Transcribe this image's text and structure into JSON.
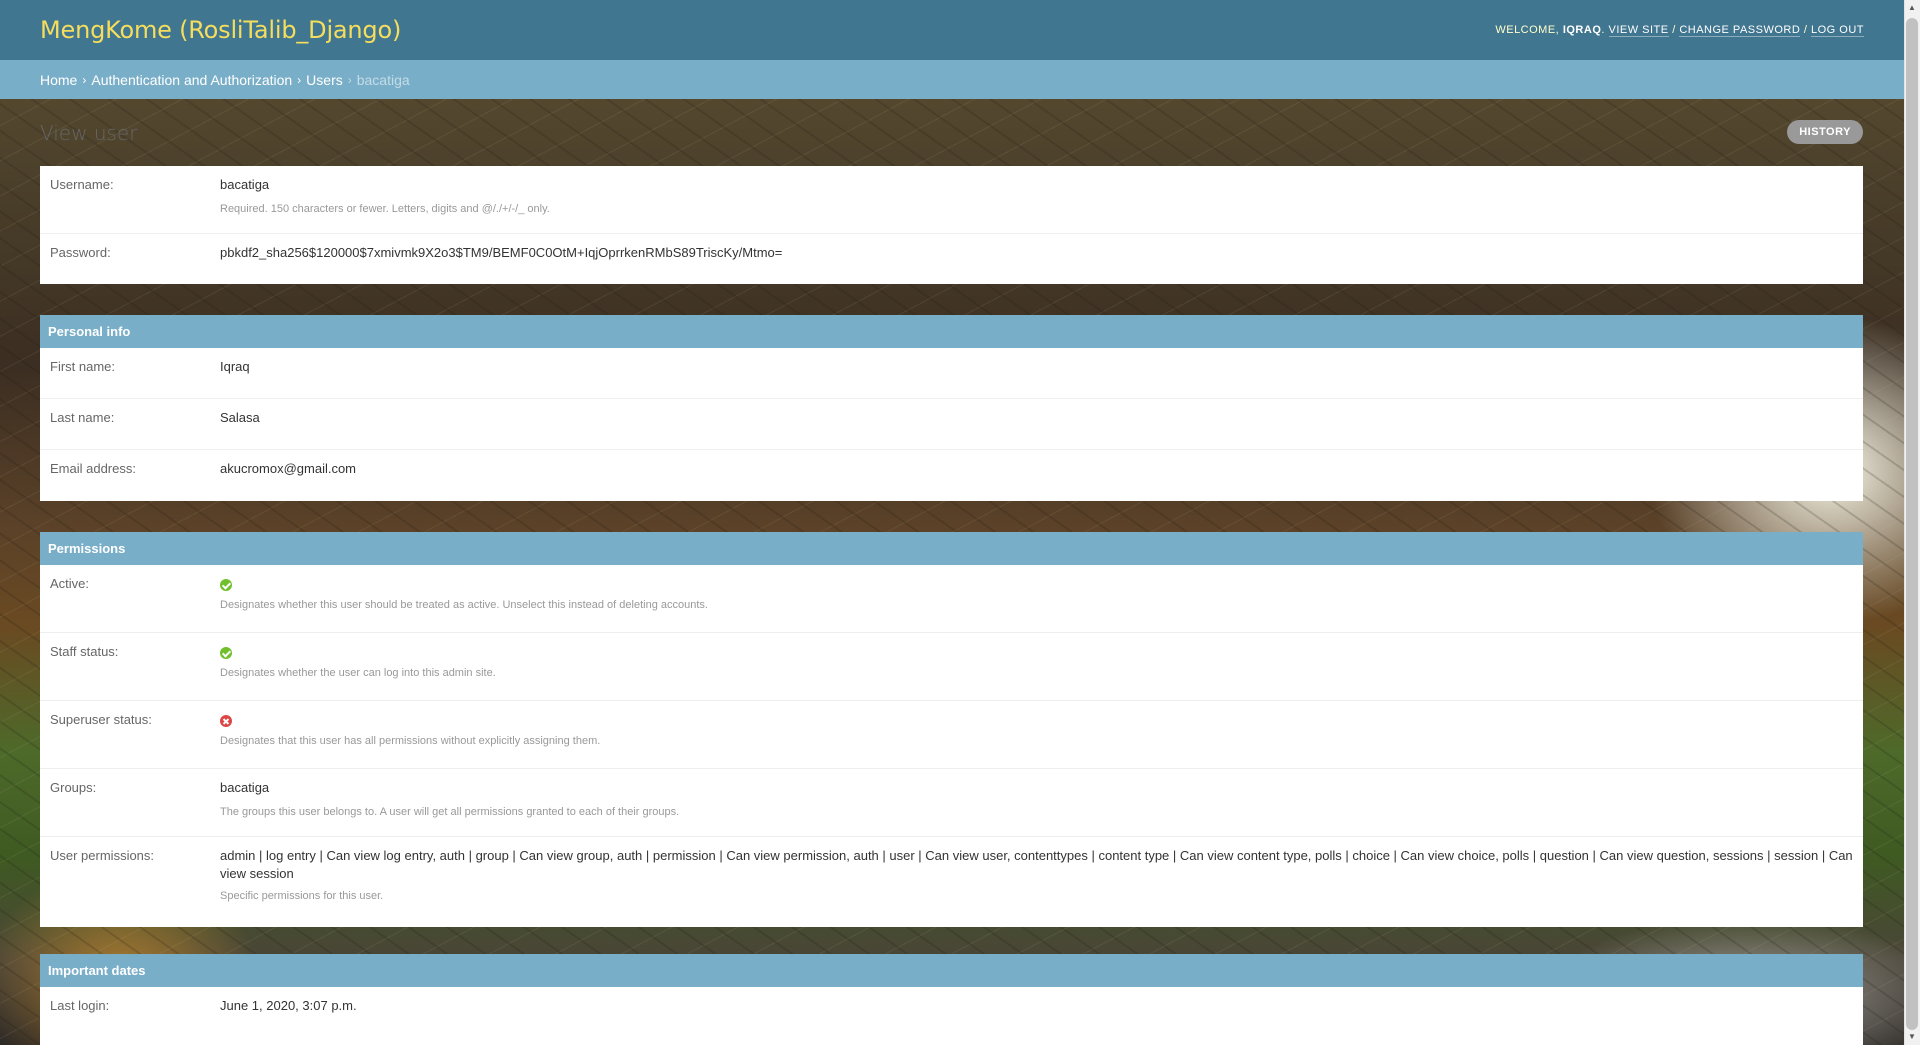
{
  "header": {
    "site_name": "MengKome (RosliTalib_Django)",
    "welcome": "Welcome,",
    "username": "IQRAQ",
    "view_site": "View site",
    "change_password": "Change password",
    "log_out": "Log out"
  },
  "breadcrumbs": {
    "home": "Home",
    "app": "Authentication and Authorization",
    "model": "Users",
    "current": "bacatiga"
  },
  "content": {
    "title": "View user",
    "history_label": "History"
  },
  "account": {
    "username_label": "Username:",
    "username_value": "bacatiga",
    "username_help": "Required. 150 characters or fewer. Letters, digits and @/./+/-/_ only.",
    "password_label": "Password:",
    "password_value": "pbkdf2_sha256$120000$7xmivmk9X2o3$TM9/BEMF0C0OtM+IqjOprrkenRMbS89TriscKy/Mtmo="
  },
  "personal_info": {
    "heading": "Personal info",
    "first_name_label": "First name:",
    "first_name_value": "Iqraq",
    "last_name_label": "Last name:",
    "last_name_value": "Salasa",
    "email_label": "Email address:",
    "email_value": "akucromox@gmail.com"
  },
  "permissions": {
    "heading": "Permissions",
    "active_label": "Active:",
    "active_value": true,
    "active_help": "Designates whether this user should be treated as active. Unselect this instead of deleting accounts.",
    "staff_label": "Staff status:",
    "staff_value": true,
    "staff_help": "Designates whether the user can log into this admin site.",
    "superuser_label": "Superuser status:",
    "superuser_value": false,
    "superuser_help": "Designates that this user has all permissions without explicitly assigning them.",
    "groups_label": "Groups:",
    "groups_value": "bacatiga",
    "groups_help": "The groups this user belongs to. A user will get all permissions granted to each of their groups.",
    "user_permissions_label": "User permissions:",
    "user_permissions_value": "admin | log entry | Can view log entry, auth | group | Can view group, auth | permission | Can view permission, auth | user | Can view user, contenttypes | content type | Can view content type, polls | choice | Can view choice, polls | question | Can view question, sessions | session | Can view session",
    "user_permissions_help": "Specific permissions for this user."
  },
  "important_dates": {
    "heading": "Important dates",
    "last_login_label": "Last login:",
    "last_login_value": "June 1, 2020, 3:07 p.m."
  },
  "colors": {
    "header_bg": "#417690",
    "branding": "#f5dd5d",
    "breadcrumbs_bg": "#79aec8",
    "module_heading_bg": "#79aec8",
    "icon_yes": "#70bf2b",
    "icon_no": "#dd4646"
  },
  "icons": {
    "active": "check-circle-icon",
    "staff": "check-circle-icon",
    "superuser": "x-circle-icon"
  }
}
